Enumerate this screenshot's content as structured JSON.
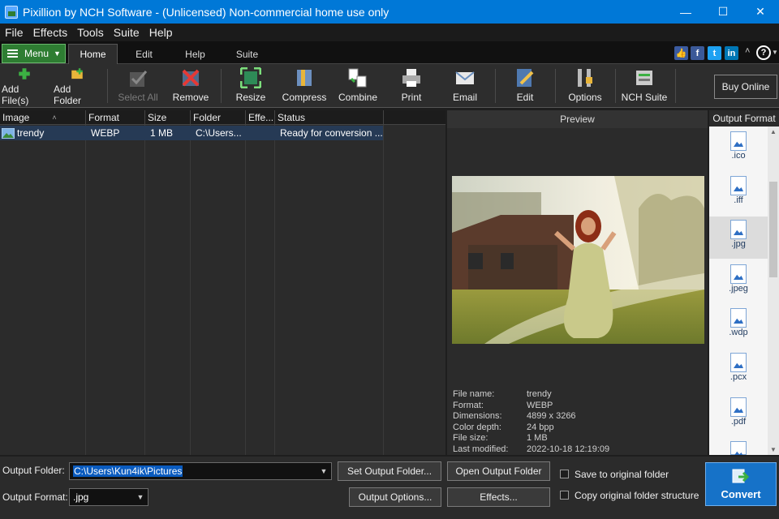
{
  "window": {
    "title": "Pixillion by NCH Software - (Unlicensed) Non-commercial home use only",
    "minimize": "—",
    "maximize": "☐",
    "close": "✕"
  },
  "menubar": [
    "File",
    "Effects",
    "Tools",
    "Suite",
    "Help"
  ],
  "tabs": {
    "menu_label": "Menu",
    "items": [
      "Home",
      "Edit",
      "Help",
      "Suite"
    ],
    "active": "Home"
  },
  "header_right": {
    "social": [
      "thumbs-up",
      "f",
      "t",
      "in"
    ],
    "help": "?"
  },
  "toolbar": {
    "add_files": "Add File(s)",
    "add_folder": "Add Folder",
    "select_all": "Select All",
    "remove": "Remove",
    "resize": "Resize",
    "compress": "Compress",
    "combine": "Combine",
    "print": "Print",
    "email": "Email",
    "edit": "Edit",
    "options": "Options",
    "nch_suite": "NCH Suite",
    "buy_online": "Buy Online"
  },
  "file_list": {
    "columns": [
      "Image",
      "Format",
      "Size",
      "Folder",
      "Effe...",
      "Status"
    ],
    "rows": [
      {
        "image": "trendy",
        "format": "WEBP",
        "size": "1 MB",
        "folder": "C:\\Users...",
        "effects": "",
        "status": "Ready for conversion ..."
      }
    ]
  },
  "preview": {
    "title": "Preview",
    "info": [
      {
        "k": "File name:",
        "v": "trendy"
      },
      {
        "k": "Format:",
        "v": "WEBP"
      },
      {
        "k": "Dimensions:",
        "v": "4899 x 3266"
      },
      {
        "k": "Color depth:",
        "v": "24 bpp"
      },
      {
        "k": "File size:",
        "v": "1 MB"
      },
      {
        "k": "Last modified:",
        "v": "2022-10-18 12:19:09"
      }
    ]
  },
  "output_format_panel": {
    "title": "Output Format",
    "formats": [
      ".ico",
      ".iff",
      ".jpg",
      ".jpeg",
      ".wdp",
      ".pcx",
      ".pdf"
    ],
    "selected": ".jpg"
  },
  "bottom": {
    "output_folder_label": "Output Folder:",
    "output_folder_value": "C:\\Users\\Kun4ik\\Pictures",
    "output_format_label": "Output Format:",
    "output_format_value": ".jpg",
    "set_output_folder": "Set Output Folder...",
    "open_output_folder": "Open Output Folder",
    "output_options": "Output Options...",
    "effects": "Effects...",
    "save_to_original": "Save to original folder",
    "copy_structure": "Copy original folder structure",
    "convert": "Convert"
  },
  "colors": {
    "titlebar": "#0078d7",
    "accent_green": "#2e7d32",
    "convert_blue": "#1672c8",
    "selected_row": "#263a55"
  }
}
